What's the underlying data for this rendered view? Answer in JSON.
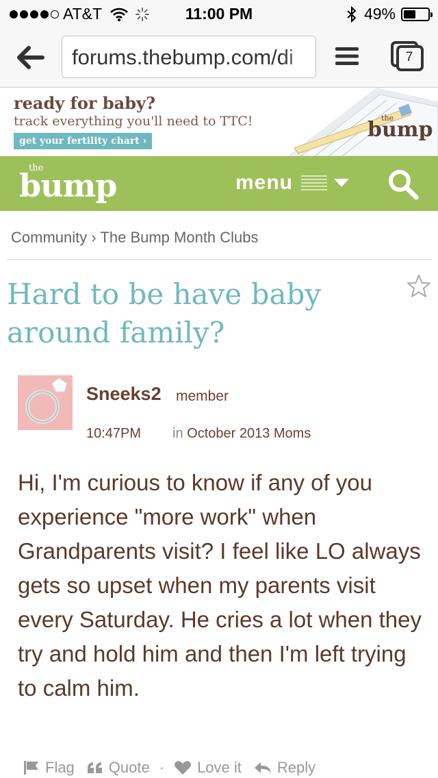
{
  "status_bar": {
    "carrier": "AT&T",
    "time": "11:00 PM",
    "battery_percent": "49%",
    "battery_level": 0.49
  },
  "browser": {
    "url": "forums.thebump.com/di",
    "tab_count": "7"
  },
  "banner": {
    "title": "ready for baby?",
    "subtitle": "track everything you'll need to TTC!",
    "cta": "get your fertility chart ›",
    "brand": "bump",
    "brand_small": "the"
  },
  "header": {
    "logo_text": "bump",
    "logo_small": "the",
    "menu_label": "menu"
  },
  "breadcrumb": {
    "items": [
      "Community",
      "The Bump Month Clubs"
    ],
    "separator": "›"
  },
  "post": {
    "title": "Hard to be have baby around family?",
    "author": "Sneeks2",
    "role": "member",
    "time": "10:47PM",
    "in_label": "in",
    "club": "October 2013 Moms",
    "body": "Hi, I'm curious to know if any of you experience \"more work\" when Grandparents visit? I feel like LO always gets so upset when my parents visit every Saturday. He cries a lot when they try and hold him and then I'm left trying to calm him."
  },
  "actions": {
    "flag": "Flag",
    "quote": "Quote",
    "separator": "·",
    "love": "Love it",
    "reply": "Reply"
  },
  "colors": {
    "header_green": "#9ec05a",
    "title_teal": "#6fb8bf",
    "text_brown": "#5a3a2a"
  }
}
